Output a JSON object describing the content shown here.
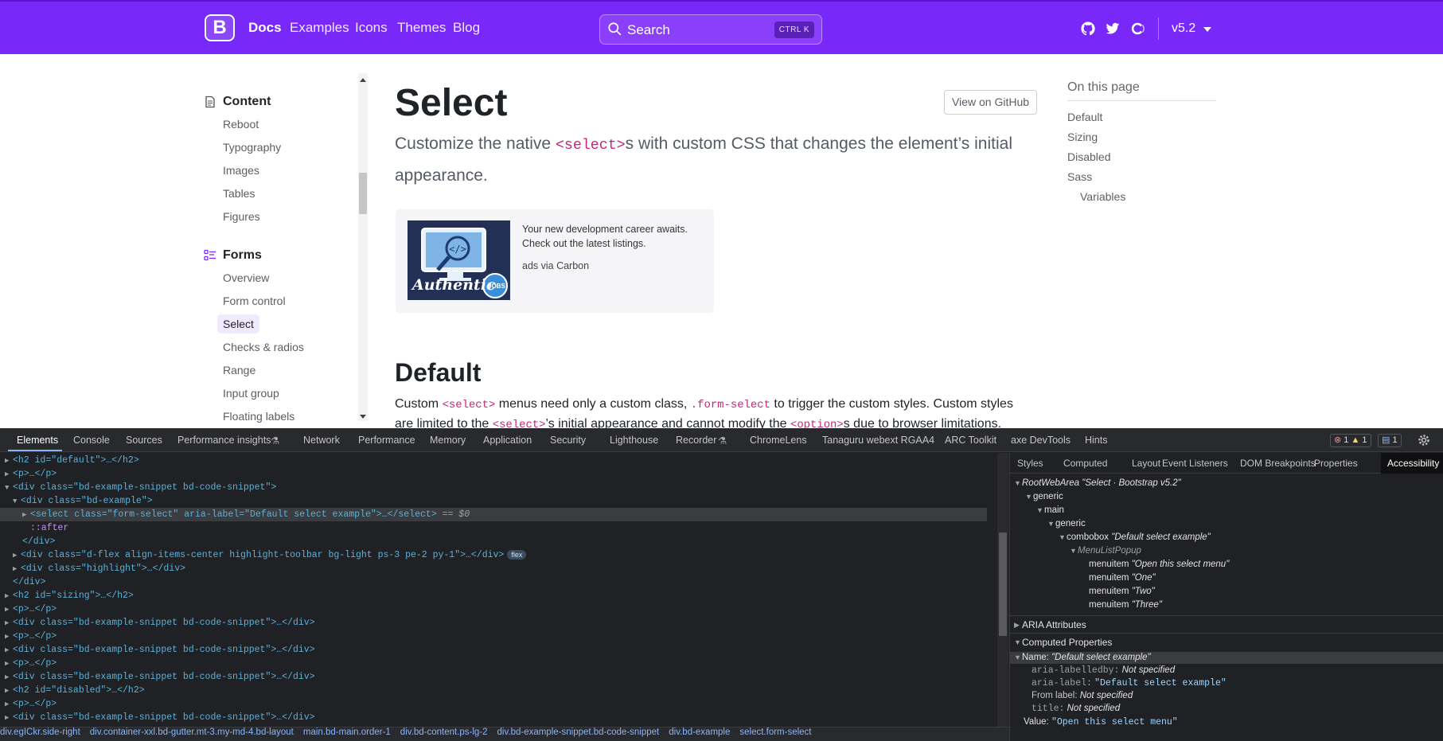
{
  "navbar": {
    "brand_letter": "B",
    "links": [
      "Docs",
      "Examples",
      "Icons",
      "Themes",
      "Blog"
    ],
    "active_link": "Docs",
    "search_placeholder": "Search",
    "search_shortcut": "CTRL K",
    "version": "v5.2",
    "icons": [
      "github-icon",
      "twitter-icon",
      "opencollective-icon"
    ],
    "color": "#7828f8"
  },
  "sidebar": {
    "sections": [
      {
        "label": "Content",
        "icon": "document-icon",
        "items": [
          "Reboot",
          "Typography",
          "Images",
          "Tables",
          "Figures"
        ]
      },
      {
        "label": "Forms",
        "icon": "list-icon",
        "items": [
          "Overview",
          "Form control",
          "Select",
          "Checks & radios",
          "Range",
          "Input group",
          "Floating labels"
        ]
      }
    ],
    "selected": "Select"
  },
  "main": {
    "title": "Select",
    "github_button": "View on GitHub",
    "lead_pre": "Customize the native ",
    "lead_code": "<select>",
    "lead_post": "s with custom CSS that changes the element’s initial appearance.",
    "ad_text": "Your new development career awaits. Check out the latest listings.",
    "ad_credit": "ads via Carbon",
    "ad_image_caption": "Authentic",
    "ad_image_badge": "JOBS",
    "h2": "Default",
    "para": {
      "t1": "Custom ",
      "c1": "<select>",
      "t2": " menus need only a custom class, ",
      "c2": ".form-select",
      "t3": " to trigger the custom styles. Custom styles are limited to the ",
      "c3": "<select>",
      "t4": "’s initial appearance and cannot modify the ",
      "c4": "<option>",
      "t5": "s due to browser limitations."
    }
  },
  "toc": {
    "heading": "On this page",
    "items": [
      "Default",
      "Sizing",
      "Disabled",
      "Sass",
      "Variables"
    ]
  },
  "devtools": {
    "tabs": [
      "Elements",
      "Console",
      "Sources",
      "Performance insights",
      "Network",
      "Performance",
      "Memory",
      "Application",
      "Security",
      "Lighthouse",
      "Recorder",
      "ChromeLens",
      "Tanaguru webext RGAA4",
      "ARC Toolkit",
      "axe DevTools",
      "Hints"
    ],
    "active_tab": "Elements",
    "errors": "1",
    "warnings": "1",
    "messages": "1",
    "dom_lines": [
      {
        "tag": "<h2 id=\"default\">…</h2>",
        "ellipsis": ""
      },
      {
        "tag": "<p>…</p>"
      },
      {
        "tag": "<div class=\"bd-example-snippet bd-code-snippet\">"
      },
      {
        "tag": "<div class=\"bd-example\">"
      },
      {
        "tag": "<select class=\"form-select\" aria-label=\"Default select example\">…</select>",
        "suffix": "== $0"
      },
      {
        "tag": "::after"
      },
      {
        "tag": "</div>"
      },
      {
        "tag": "<div class=\"d-flex align-items-center highlight-toolbar bg-light ps-3 pe-2 py-1\">…</div>",
        "badge": "flex"
      },
      {
        "tag": "<div class=\"highlight\">…</div>"
      },
      {
        "tag": "</div>"
      },
      {
        "tag": "<h2 id=\"sizing\">…</h2>"
      },
      {
        "tag": "<p>…</p>"
      },
      {
        "tag": "<div class=\"bd-example-snippet bd-code-snippet\">…</div>"
      },
      {
        "tag": "<p>…</p>"
      },
      {
        "tag": "<div class=\"bd-example-snippet bd-code-snippet\">…</div>"
      },
      {
        "tag": "<p>…</p>"
      },
      {
        "tag": "<div class=\"bd-example-snippet bd-code-snippet\">…</div>"
      },
      {
        "tag": "<h2 id=\"disabled\">…</h2>"
      },
      {
        "tag": "<p>…</p>"
      },
      {
        "tag": "<div class=\"bd-example-snippet bd-code-snippet\">…</div>"
      }
    ],
    "breadcrumbs": [
      "div.egICkr.side-right",
      "div.container-xxl.bd-gutter.mt-3.my-md-4.bd-layout",
      "main.bd-main.order-1",
      "div.bd-content.ps-lg-2",
      "div.bd-example-snippet.bd-code-snippet",
      "div.bd-example",
      "select.form-select"
    ],
    "right_tabs": [
      "Styles",
      "Computed",
      "Layout",
      "Event Listeners",
      "DOM Breakpoints",
      "Properties",
      "Accessibility"
    ],
    "right_active": "Accessibility",
    "ax_tree": [
      {
        "role": "RootWebArea",
        "name": "\"Select · Bootstrap v5.2\""
      },
      {
        "role": "generic",
        "name": ""
      },
      {
        "role": "main",
        "name": ""
      },
      {
        "role": "generic",
        "name": ""
      },
      {
        "role": "combobox",
        "name": "\"Default select example\""
      },
      {
        "role": "MenuListPopup",
        "name": ""
      },
      {
        "role": "menuitem",
        "name": "\"Open this select menu\""
      },
      {
        "role": "menuitem",
        "name": "\"One\""
      },
      {
        "role": "menuitem",
        "name": "\"Two\""
      },
      {
        "role": "menuitem",
        "name": "\"Three\""
      }
    ],
    "sections": {
      "aria": "ARIA Attributes",
      "computed": "Computed Properties"
    },
    "computed": {
      "name_label": "Name:",
      "name_value": "\"Default select example\"",
      "props": [
        {
          "k": "aria-labelledby:",
          "v": "Not specified",
          "type": "italic"
        },
        {
          "k": "aria-label:",
          "v": "\"Default select example\"",
          "type": "string"
        },
        {
          "k": "From label:",
          "v": "Not specified",
          "type": "italic"
        },
        {
          "k": "title:",
          "v": "Not specified",
          "type": "italic"
        }
      ],
      "value_label": "Value:",
      "value_value": "\"Open this select menu\""
    }
  }
}
